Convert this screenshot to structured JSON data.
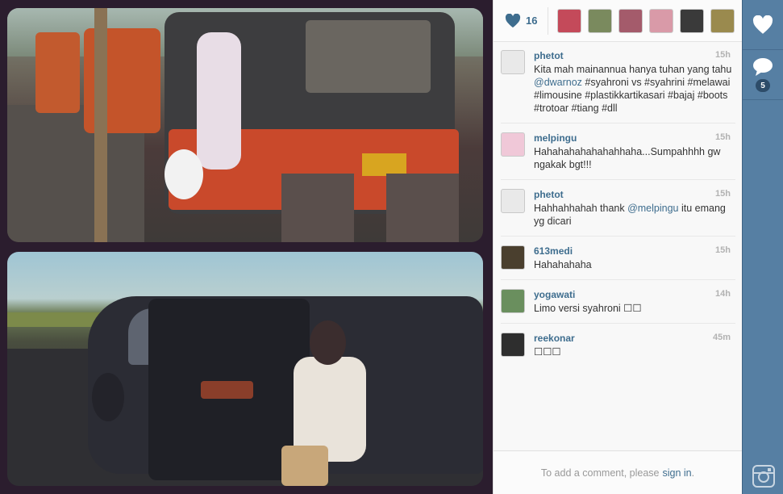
{
  "likes": {
    "count": "16",
    "likers": [
      {
        "color": "#c44a5a"
      },
      {
        "color": "#7a8a5e"
      },
      {
        "color": "#a45b6b"
      },
      {
        "color": "#d99aa8"
      },
      {
        "color": "#3a3a3a"
      },
      {
        "color": "#9a8a4e"
      }
    ]
  },
  "comments": [
    {
      "user": "phetot",
      "time": "15h",
      "avatar_color": "#e9e9e9",
      "text_before": "Kita mah mainannua hanya tuhan yang tahu ",
      "mention": "@dwarnoz",
      "text_after": " #syahroni vs #syahrini #melawai #limousine #plastikkartikasari #bajaj #boots #trotoar #tiang #dll"
    },
    {
      "user": "melpingu",
      "time": "15h",
      "avatar_color": "#f0c8d8",
      "text_before": "Hahahahahahahahhaha...Sumpahhhh gw ngakak bgt!!!",
      "mention": "",
      "text_after": ""
    },
    {
      "user": "phetot",
      "time": "15h",
      "avatar_color": "#e9e9e9",
      "text_before": "Hahhahhahah thank ",
      "mention": "@melpingu",
      "text_after": " itu emang yg dicari"
    },
    {
      "user": "613medi",
      "time": "15h",
      "avatar_color": "#4a3f2e",
      "text_before": "Hahahahaha",
      "mention": "",
      "text_after": ""
    },
    {
      "user": "yogawati",
      "time": "14h",
      "avatar_color": "#6a8f5e",
      "text_before": "Limo versi syahroni ☐☐",
      "mention": "",
      "text_after": ""
    },
    {
      "user": "reekonar",
      "time": "45m",
      "avatar_color": "#2e2e2e",
      "text_before": "☐☐☐",
      "mention": "",
      "text_after": ""
    }
  ],
  "add_comment": {
    "prompt": "To add a comment, please",
    "link": "sign in",
    "suffix": "."
  },
  "actions": {
    "comment_count": "5"
  }
}
